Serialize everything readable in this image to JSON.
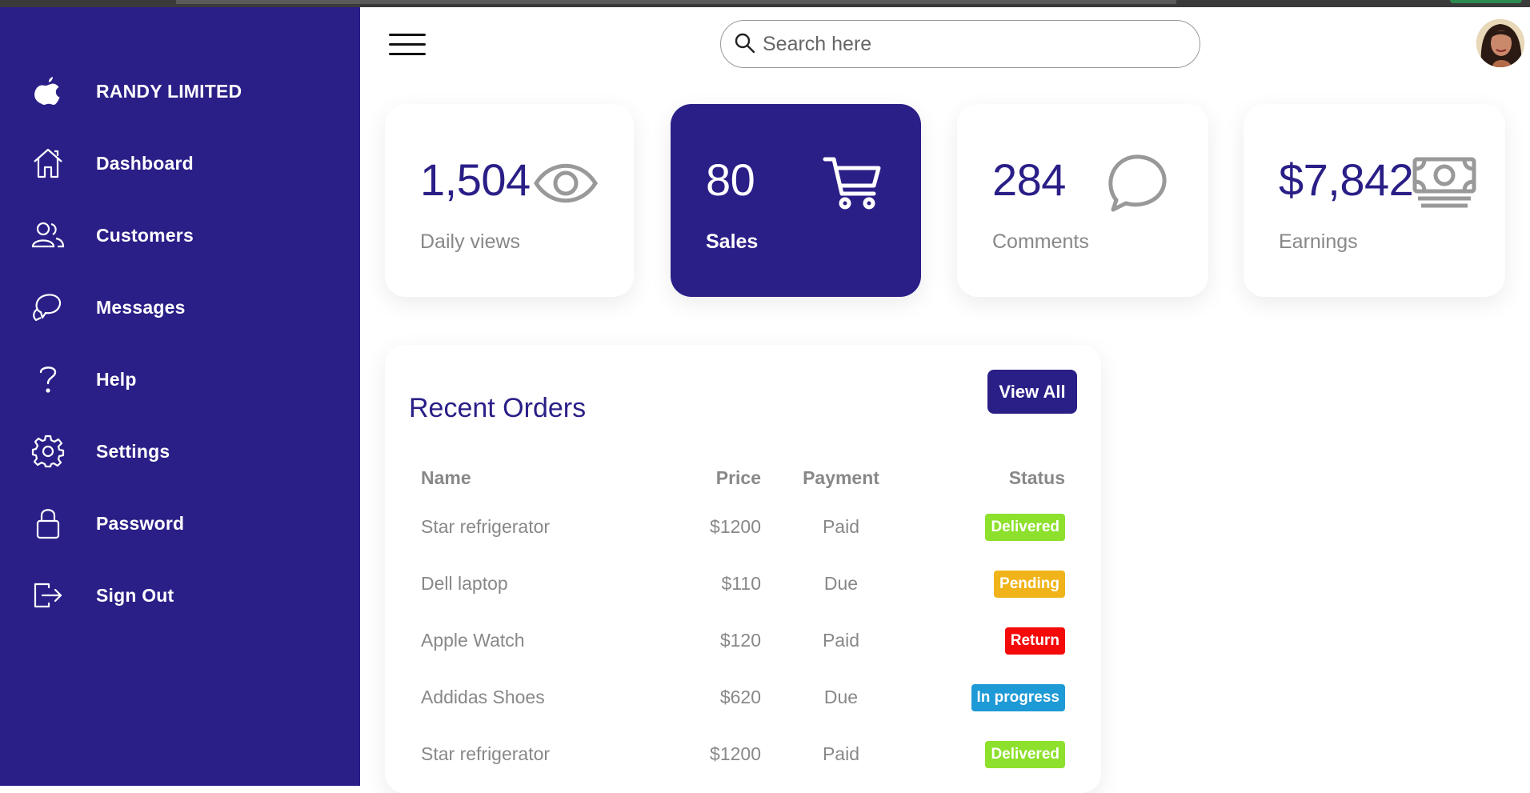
{
  "brand": {
    "name": "RANDY LIMITED",
    "icon": "apple-icon"
  },
  "sidebar": {
    "items": [
      {
        "label": "Dashboard",
        "icon": "home-icon"
      },
      {
        "label": "Customers",
        "icon": "people-icon"
      },
      {
        "label": "Messages",
        "icon": "chat-icon"
      },
      {
        "label": "Help",
        "icon": "help-icon"
      },
      {
        "label": "Settings",
        "icon": "gear-icon"
      },
      {
        "label": "Password",
        "icon": "lock-icon"
      },
      {
        "label": "Sign Out",
        "icon": "sign-out-icon"
      }
    ]
  },
  "search": {
    "placeholder": "Search here",
    "value": ""
  },
  "cards": [
    {
      "number": "1,504",
      "caption": "Daily views",
      "icon": "eye-icon"
    },
    {
      "number": "80",
      "caption": "Sales",
      "icon": "cart-icon"
    },
    {
      "number": "284",
      "caption": "Comments",
      "icon": "comment-icon"
    },
    {
      "number": "$7,842",
      "caption": "Earnings",
      "icon": "cash-icon"
    }
  ],
  "orders": {
    "title": "Recent Orders",
    "view_all": "View All",
    "columns": {
      "name": "Name",
      "price": "Price",
      "payment": "Payment",
      "status": "Status"
    },
    "rows": [
      {
        "name": "Star refrigerator",
        "price": "$1200",
        "payment": "Paid",
        "status": "Delivered"
      },
      {
        "name": "Dell laptop",
        "price": "$110",
        "payment": "Due",
        "status": "Pending"
      },
      {
        "name": "Apple Watch",
        "price": "$120",
        "payment": "Paid",
        "status": "Return"
      },
      {
        "name": "Addidas Shoes",
        "price": "$620",
        "payment": "Due",
        "status": "In progress"
      },
      {
        "name": "Star refrigerator",
        "price": "$1200",
        "payment": "Paid",
        "status": "Delivered"
      }
    ]
  },
  "colors": {
    "primary": "#2a1f87",
    "delivered": "#8de02c",
    "pending": "#f0b41a",
    "return": "#f50a0a",
    "in_progress": "#1e9ad6"
  }
}
